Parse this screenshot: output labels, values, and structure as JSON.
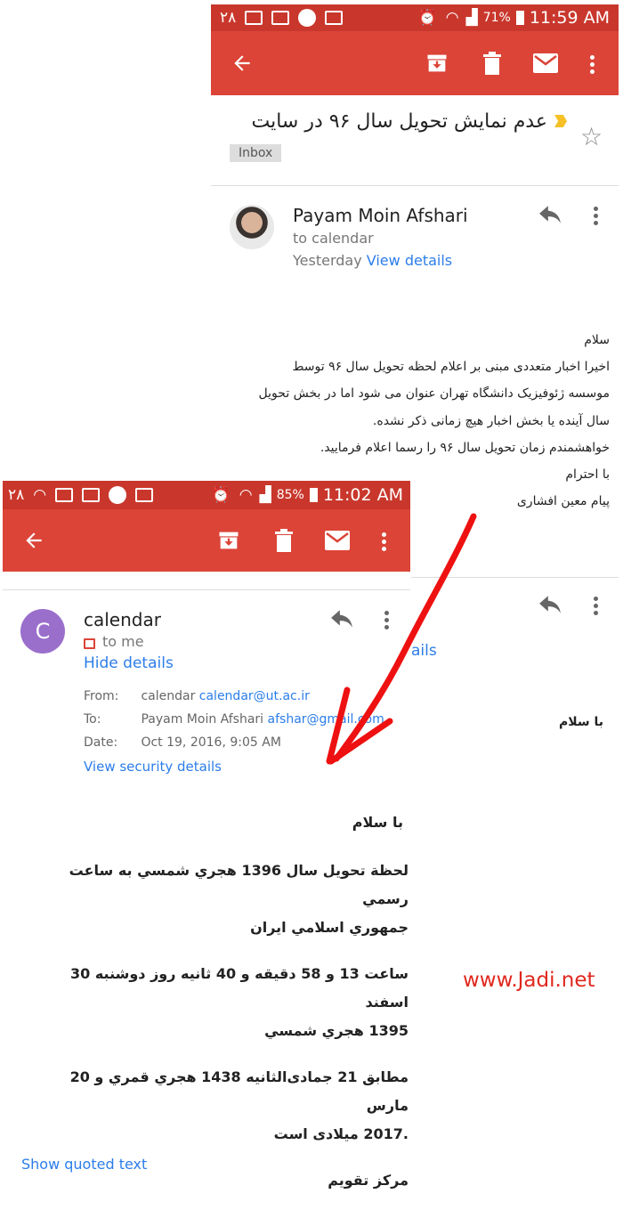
{
  "top": {
    "status": {
      "left_num": "۲۸",
      "battery": "71%",
      "time": "11:59 AM"
    },
    "subject": "عدم نمایش تحویل سال ۹۶ در سایت",
    "label": "Inbox",
    "sender": "Payam Moin Afshari",
    "recipient": "to calendar",
    "date": "Yesterday",
    "view_details": "View details",
    "body": [
      "سلام",
      "اخیرا اخبار متعددی مبنی بر اعلام لحظه تحویل سال ۹۶ توسط",
      "موسسه ژئوفیزیک دانشگاه تهران عنوان می شود اما در بخش تحویل",
      "سال آینده یا بخش اخبار هیچ زمانی ذکر نشده.",
      "خواهشمندم زمان تحویل سال ۹۶ را رسما اعلام فرمایید.",
      "با احترام",
      "پیام معین افشاری"
    ],
    "underlay_link": "ails",
    "underlay_greeting": "با سلام"
  },
  "overlay": {
    "status": {
      "left_num": "۲۸",
      "battery": "85%",
      "time": "11:02 AM"
    },
    "avatar_letter": "C",
    "sender": "calendar",
    "recipient": "to me",
    "hide_details": "Hide details",
    "details": {
      "from_label": "From:",
      "from_name": "calendar",
      "from_email": "calendar@ut.ac.ir",
      "to_label": "To:",
      "to_name": "Payam Moin Afshari",
      "to_email": "afshar@gmail.com",
      "date_label": "Date:",
      "date_value": "Oct 19, 2016, 9:05 AM"
    },
    "security": "View security details",
    "body": {
      "greeting": "با سلام",
      "p1a": "لحظة تحويل سال 1396 هجري شمسي به ساعت رسمي",
      "p1b": "جمهوري اسلامي ايران",
      "p2a": "ساعت 13 و 58 دقيقه و 40 ثانيه روز دوشنبه 30 اسفند",
      "p2b": "1395 هجري شمسي",
      "p3a": "مطابق 21 جمادی‌الثانيه 1438 هجري قمري و 20 مارس",
      "p3b": ".2017 میلادی است",
      "sign": "مركز تقويم"
    },
    "show_quoted": "Show quoted text"
  },
  "watermark": "www.Jadi.net",
  "colors": {
    "appbar": "#db4437",
    "statusbar": "#c9372c",
    "link": "#2b7de9",
    "arrow": "#ee1111",
    "avatar": "#9a6fcb",
    "watermark": "#e0281e"
  }
}
